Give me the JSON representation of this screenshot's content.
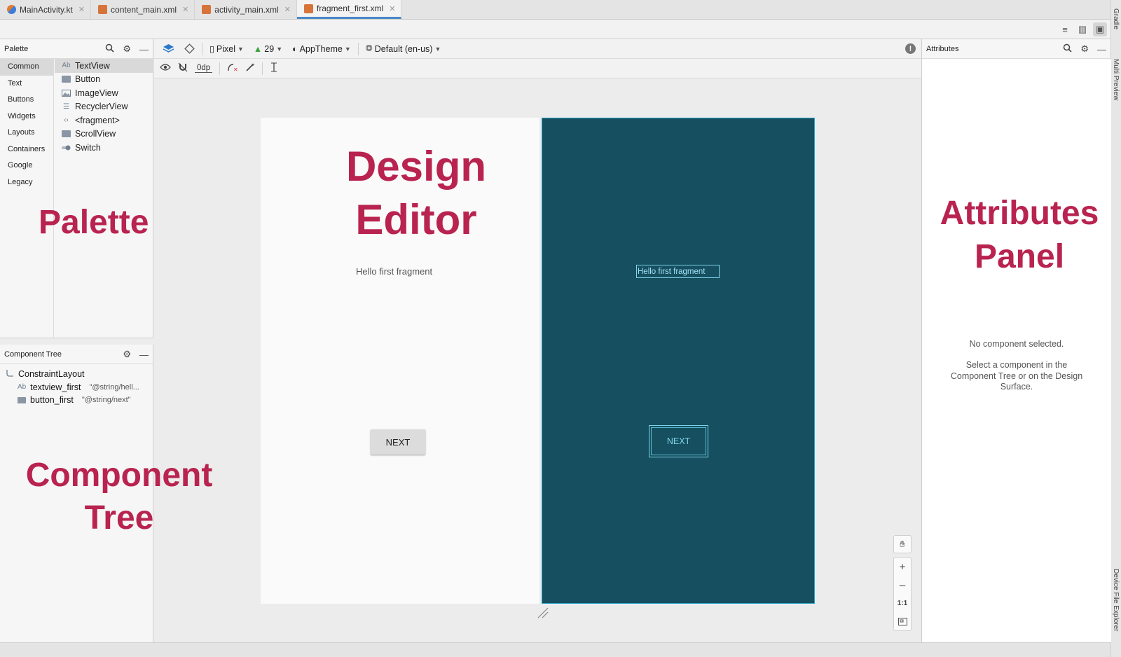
{
  "tabs": [
    {
      "label": "MainActivity.kt",
      "icon": "kotlin-file-icon",
      "active": false
    },
    {
      "label": "content_main.xml",
      "icon": "xml-file-icon",
      "active": false
    },
    {
      "label": "activity_main.xml",
      "icon": "xml-file-icon",
      "active": false
    },
    {
      "label": "fragment_first.xml",
      "icon": "xml-file-icon",
      "active": true
    }
  ],
  "right_strip": {
    "gradle": "Gradle",
    "multi_preview": "Multi Preview",
    "device_file_explorer": "Device File Explorer"
  },
  "palette": {
    "title": "Palette",
    "categories": [
      "Common",
      "Text",
      "Buttons",
      "Widgets",
      "Layouts",
      "Containers",
      "Google",
      "Legacy"
    ],
    "items": [
      "TextView",
      "Button",
      "ImageView",
      "RecyclerView",
      "<fragment>",
      "ScrollView",
      "Switch"
    ],
    "textview_icon": "Ab"
  },
  "component_tree": {
    "title": "Component Tree",
    "root": "ConstraintLayout",
    "children": [
      {
        "icon": "Ab",
        "name": "textview_first",
        "value": "\"@string/hell..."
      },
      {
        "icon": "",
        "name": "button_first",
        "value": "\"@string/next\""
      }
    ]
  },
  "toolbar": {
    "device": "Pixel",
    "api": "29",
    "theme": "AppTheme",
    "locale": "Default (en-us)",
    "margin": "0dp"
  },
  "design": {
    "hello_text": "Hello first fragment",
    "next_label": "NEXT",
    "blueprint_hello": "Hello first fragment",
    "blueprint_next": "NEXT"
  },
  "zoom": {
    "plus": "+",
    "minus": "–",
    "one_to_one": "1:1"
  },
  "attributes": {
    "title": "Attributes",
    "no_component": "No component selected.",
    "hint": "Select a component in the Component Tree or on the Design Surface."
  },
  "overlay_labels": {
    "palette": "Palette",
    "design_line1": "Design",
    "design_line2": "Editor",
    "attributes_line1": "Attributes",
    "attributes_line2": "Panel",
    "component_line1": "Component",
    "component_line2": "Tree"
  },
  "colors": {
    "overlay": "#b9234f",
    "blueprint": "#164f5f",
    "blueprint_outline": "#7fd3ea"
  }
}
